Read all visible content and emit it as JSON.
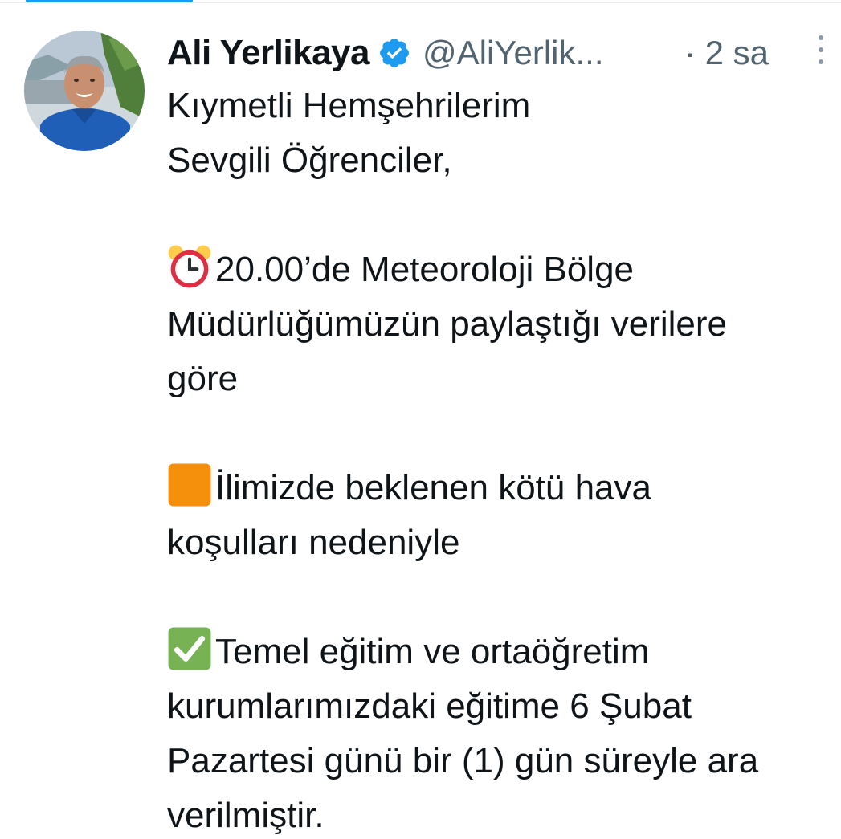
{
  "tweet": {
    "author": {
      "display_name": "Ali Yerlikaya",
      "handle": "@AliYerlik...",
      "verified_icon": "verified-badge-icon",
      "avatar_icon": "avatar"
    },
    "timestamp": "· 2 sa",
    "more_icon": "more-options-icon",
    "paragraphs": [
      {
        "lines": [
          "Kıymetli Hemşehrilerim",
          "Sevgili Öğrenciler,"
        ]
      },
      {
        "emoji": "alarm-clock-emoji",
        "lines": [
          "20.00’de Meteoroloji Bölge",
          "Müdürlüğümüzün paylaştığı verilere",
          "göre"
        ]
      },
      {
        "emoji": "orange-square-emoji",
        "lines": [
          "İlimizde beklenen kötü hava",
          "koşulları nedeniyle"
        ]
      },
      {
        "emoji": "check-mark-button-emoji",
        "lines": [
          "Temel eğitim ve ortaöğretim",
          "kurumlarımızdaki eğitime 6 Şubat",
          "Pazartesi günü bir (1) gün süreyle ara",
          "verilmiştir."
        ]
      }
    ]
  },
  "colors": {
    "accent": "#1d9bf0",
    "text": "#0f1419",
    "secondary_text": "#536471",
    "alarm_red": "#dd2e44",
    "orange": "#f4900c",
    "check_green": "#77b255"
  }
}
